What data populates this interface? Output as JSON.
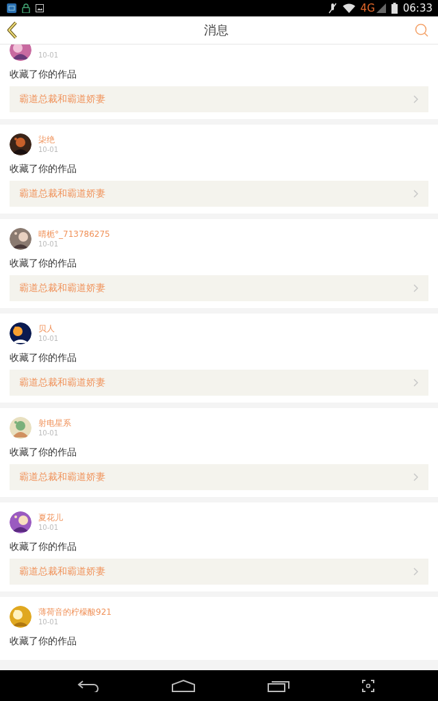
{
  "status_bar": {
    "network": "4G",
    "time": "06:33"
  },
  "header": {
    "title": "消息"
  },
  "messages": [
    {
      "date": "10-01",
      "action": "收藏了你的作品",
      "work": "霸道总裁和霸道娇妻"
    },
    {
      "user": "柒绝",
      "date": "10-01",
      "action": "收藏了你的作品",
      "work": "霸道总裁和霸道娇妻"
    },
    {
      "user": "晴栀°_713786275",
      "date": "10-01",
      "action": "收藏了你的作品",
      "work": "霸道总裁和霸道娇妻"
    },
    {
      "user": "贝人",
      "date": "10-01",
      "action": "收藏了你的作品",
      "work": "霸道总裁和霸道娇妻"
    },
    {
      "user": "射电星系",
      "date": "10-01",
      "action": "收藏了你的作品",
      "work": "霸道总裁和霸道娇妻"
    },
    {
      "user": "夏花儿",
      "date": "10-01",
      "action": "收藏了你的作品",
      "work": "霸道总裁和霸道娇妻"
    },
    {
      "user": "薄荷音的柠檬酸921",
      "date": "10-01",
      "action": "收藏了你的作品"
    }
  ]
}
